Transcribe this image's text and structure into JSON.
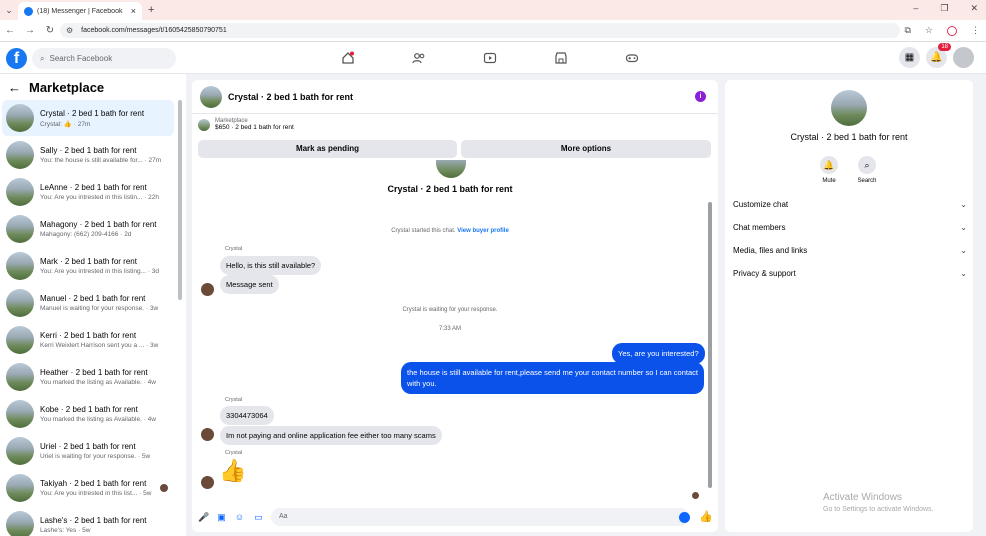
{
  "browser": {
    "tab_title": "(18) Messenger | Facebook",
    "url_prefix": "facebook.com",
    "url": "facebook.com/messages/t/1605425850790751"
  },
  "header": {
    "logo": "f",
    "search_placeholder": "Search Facebook",
    "notification_count": "18",
    "nav_icons": [
      "home-icon",
      "friends-icon",
      "watch-icon",
      "marketplace-icon",
      "gaming-icon"
    ]
  },
  "sidebar": {
    "title": "Marketplace",
    "conversations": [
      {
        "name": "Crystal · 2 bed 1 bath for rent",
        "snippet": "Crystal: 👍 · 27m",
        "active": true
      },
      {
        "name": "Sally · 2 bed 1 bath for rent",
        "snippet": "You: the house is still available for... · 27m"
      },
      {
        "name": "LeAnne · 2 bed 1 bath for rent",
        "snippet": "You: Are you intrested in this listin... · 22h"
      },
      {
        "name": "Mahagony · 2 bed 1 bath for rent",
        "snippet": "Mahagony: (662) 209-4166 · 2d"
      },
      {
        "name": "Mark · 2 bed 1 bath for rent",
        "snippet": "You: Are you intrested in this listing... · 3d"
      },
      {
        "name": "Manuel · 2 bed 1 bath for rent",
        "snippet": "Manuel is waiting for your response. · 3w"
      },
      {
        "name": "Kerri · 2 bed 1 bath for rent",
        "snippet": "Kerri Weixlert Harrison sent you a ... · 3w"
      },
      {
        "name": "Heather · 2 bed 1 bath for rent",
        "snippet": "You marked the listing as Available. · 4w"
      },
      {
        "name": "Kobe · 2 bed 1 bath for rent",
        "snippet": "You marked the listing as Available. · 4w"
      },
      {
        "name": "Uriel · 2 bed 1 bath for rent",
        "snippet": "Uriel is waiting for your response. · 5w"
      },
      {
        "name": "Takiyah · 2 bed 1 bath for rent",
        "snippet": "You: Are you intrested in this list... · 5w"
      },
      {
        "name": "Lashe's · 2 bed 1 bath for rent",
        "snippet": "Lashe's: Yes · 5w"
      }
    ]
  },
  "chat": {
    "title": "Crystal · 2 bed 1 bath for rent",
    "marketplace_label": "Marketplace",
    "listing": "$650 · 2 bed 1 bath for rent",
    "pending_button": "Mark as pending",
    "more_button": "More options",
    "intro_title": "Crystal · 2 bed 1 bath for rent",
    "started_text": "Crystal started this chat.",
    "buyer_profile_link": "View buyer profile",
    "sender_name": "Crystal",
    "msg1": "Hello, is this still available?",
    "msg2": "Message sent",
    "waiting_text": "Crystal is waiting for your response.",
    "time": "7:33 AM",
    "out1": "Yes, are you interested?",
    "out2": "the house is still available for rent,please send me your contact number so I can contact with you.",
    "msg3": "3304473064",
    "msg4": "Im not paying and online application fee either too many scams",
    "composer_placeholder": "Aa"
  },
  "details": {
    "title": "Crystal · 2 bed 1 bath for rent",
    "mute_label": "Mute",
    "search_label": "Search",
    "sections": [
      "Customize chat",
      "Chat members",
      "Media, files and links",
      "Privacy & support"
    ]
  },
  "watermark": {
    "line1": "Activate Windows",
    "line2": "Go to Settings to activate Windows."
  }
}
